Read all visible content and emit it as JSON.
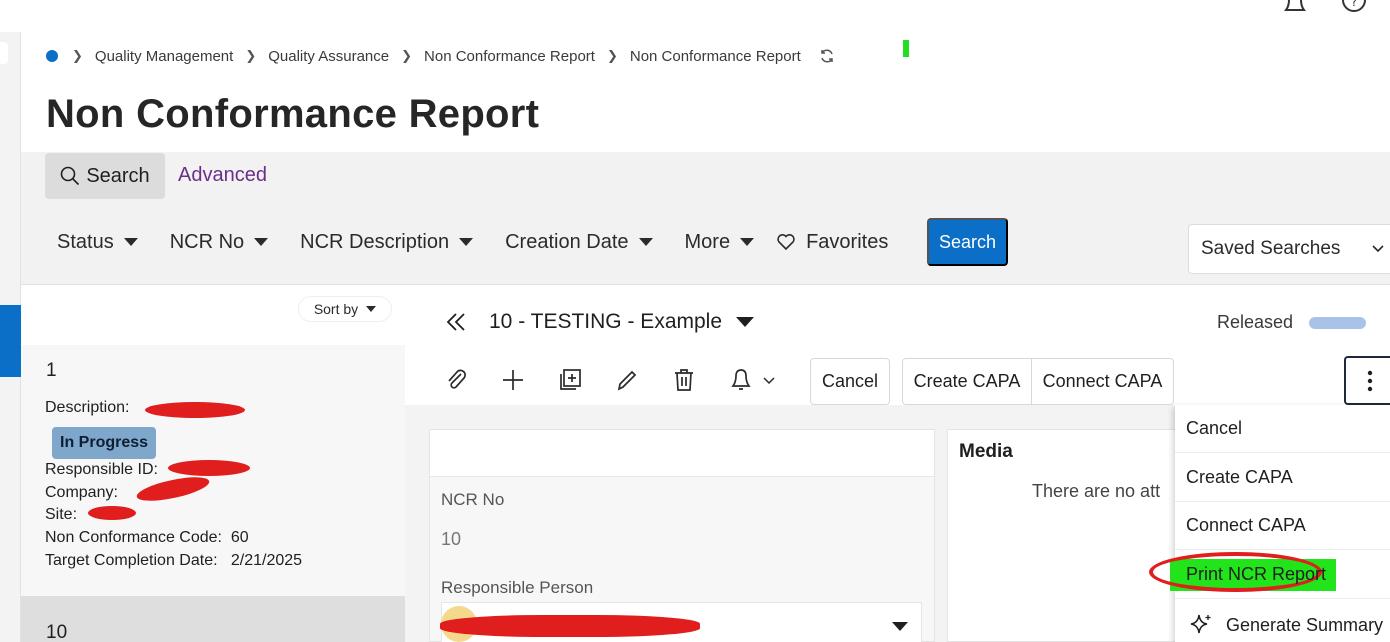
{
  "breadcrumb": {
    "items": [
      "Quality Management",
      "Quality Assurance",
      "Non Conformance Report",
      "Non Conformance Report"
    ]
  },
  "page": {
    "title": "Non Conformance Report"
  },
  "search": {
    "tab_search": "Search",
    "tab_advanced": "Advanced",
    "filters": [
      "Status",
      "NCR No",
      "NCR Description",
      "Creation Date",
      "More"
    ],
    "favorites": "Favorites",
    "search_button": "Search",
    "saved_searches": "Saved Searches"
  },
  "list": {
    "sort_by": "Sort by",
    "items": [
      {
        "number": "1",
        "description_label": "Description:",
        "status": "In Progress",
        "responsible_label": "Responsible ID:",
        "company_label": "Company:",
        "site_label": "Site:",
        "code_label": "Non Conformance Code:",
        "code_value": "60",
        "target_label": "Target Completion Date:",
        "target_value": "2/21/2025"
      },
      {
        "number": "10"
      }
    ]
  },
  "detail": {
    "record_title": "10 - TESTING - Example",
    "state": "Released",
    "toolbar": {
      "cancel": "Cancel",
      "create_capa": "Create CAPA",
      "connect_capa": "Connect CAPA"
    },
    "fields": {
      "ncr_no_label": "NCR No",
      "ncr_no_value": "10",
      "responsible_person_label": "Responsible Person"
    },
    "media": {
      "title": "Media",
      "empty_text": "There are no att"
    }
  },
  "menu": {
    "items": [
      "Cancel",
      "Create CAPA",
      "Connect CAPA",
      "Print NCR Report",
      "Generate Summary"
    ]
  },
  "colors": {
    "accent": "#0b6fc7",
    "status_badge": "#7fa7cc",
    "advanced_link": "#6b2f8a",
    "highlight_green": "#22e41a",
    "annotation_red": "#e01e1e"
  }
}
